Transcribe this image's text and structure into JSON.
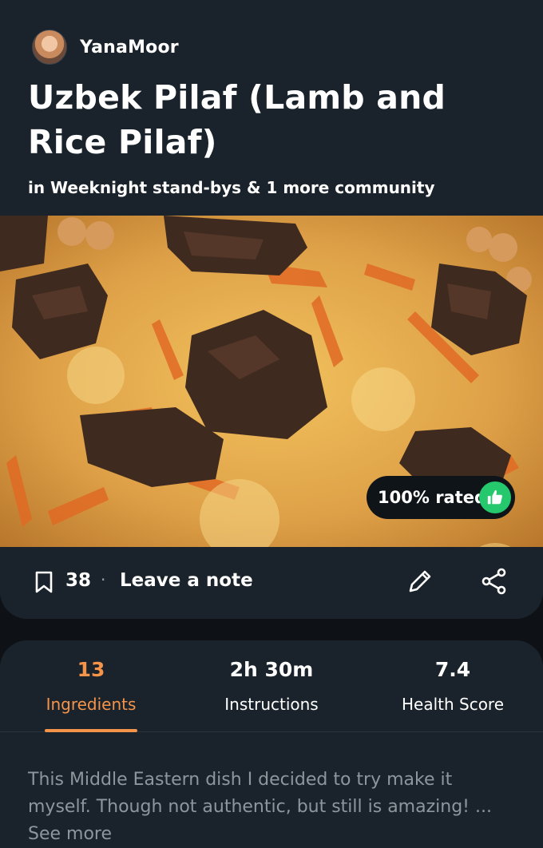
{
  "author": {
    "name": "YanaMoor",
    "avatar_icon": "user-avatar"
  },
  "recipe": {
    "title": "Uzbek Pilaf  (Lamb and Rice Pilaf)",
    "community": "in Weeknight stand-bys & 1 more community",
    "rating_badge": "100% rated",
    "save_count": "38",
    "separator": "·",
    "leave_note_label": "Leave a note",
    "description": "This Middle Eastern dish I decided to try make it myself. Though not authentic, but still is amazing! ...",
    "see_more_label": "See more"
  },
  "stats": {
    "ingredients": {
      "value": "13",
      "label": "Ingredients"
    },
    "instructions": {
      "value": "2h 30m",
      "label": "Instructions"
    },
    "health": {
      "value": "7.4",
      "label": "Health Score"
    }
  },
  "colors": {
    "accent": "#f4934a",
    "rating_green": "#25c86c",
    "card_bg": "#1a232b",
    "page_bg": "#0e1216"
  },
  "icons": {
    "bookmark": "bookmark-icon",
    "edit": "pencil-icon",
    "share": "share-icon",
    "thumb": "thumbs-up-icon"
  }
}
